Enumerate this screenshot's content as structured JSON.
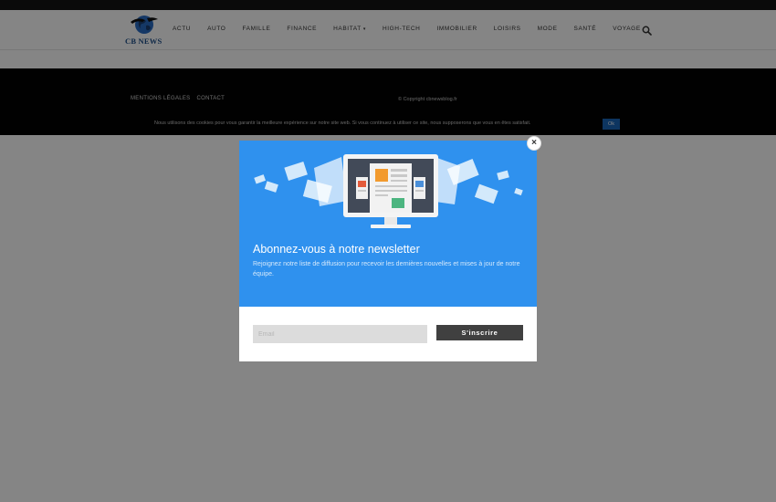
{
  "logo": {
    "text": "CB NEWS"
  },
  "nav": {
    "items": [
      {
        "label": "ACTU",
        "caret": ""
      },
      {
        "label": "AUTO",
        "caret": ""
      },
      {
        "label": "FAMILLE",
        "caret": ""
      },
      {
        "label": "FINANCE",
        "caret": ""
      },
      {
        "label": "HABITAT",
        "caret": "▾"
      },
      {
        "label": "HIGH-TECH",
        "caret": ""
      },
      {
        "label": "IMMOBILIER",
        "caret": ""
      },
      {
        "label": "LOISIRS",
        "caret": ""
      },
      {
        "label": "MODE",
        "caret": ""
      },
      {
        "label": "SANTÉ",
        "caret": ""
      },
      {
        "label": "VOYAGE",
        "caret": ""
      }
    ],
    "search_icon": "search-icon"
  },
  "footer": {
    "links": [
      "MENTIONS LÉGALES",
      "CONTACT"
    ],
    "copyright": "© Copyright cbnewsblog.fr"
  },
  "cookie": {
    "text": "Nous utilisons des cookies pour vous garantir la meilleure expérience sur notre site web. Si vous continuez à utiliser ce site, nous supposerons que vous en êtes satisfait.",
    "ok_label": "Ok"
  },
  "modal": {
    "title": "Abonnez-vous à notre newsletter",
    "description": "Rejoignez notre liste de diffusion pour recevoir les dernières nouvelles et mises à jour de notre équipe.",
    "email_placeholder": "Email",
    "subscribe_label": "S'inscrire",
    "close_icon": "close-icon"
  },
  "colors": {
    "modal_blue": "#2f91ee",
    "footer_black": "#020202",
    "cookie_button": "#1a66b8",
    "subscribe_button": "#404040",
    "logo_blue": "#1e4f8a"
  }
}
